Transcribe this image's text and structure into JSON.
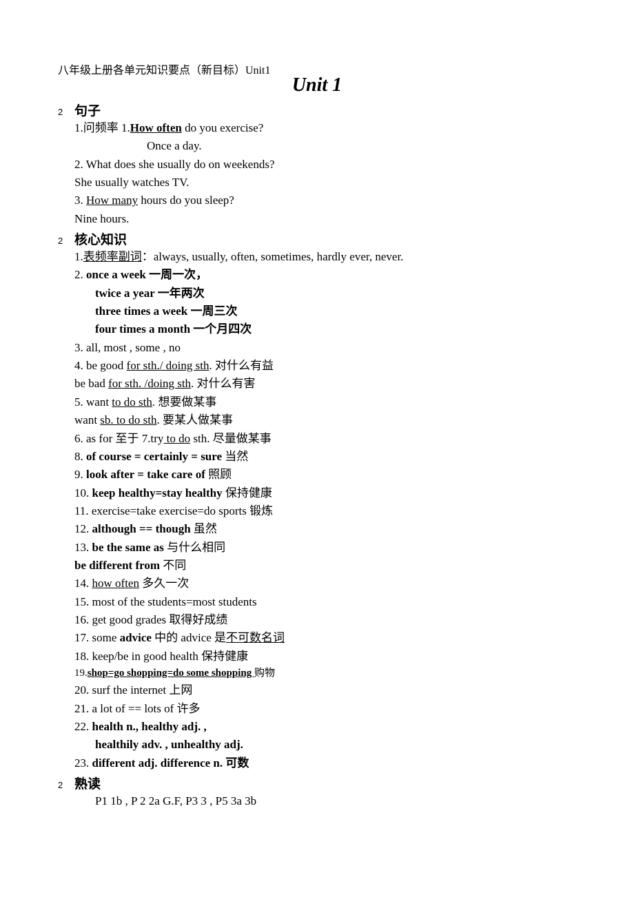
{
  "header": "八年级上册各单元知识要点（新目标）Unit1",
  "title": "Unit 1",
  "sec_bullet": "2",
  "sections": {
    "juzi": {
      "label": "句子",
      "l1_pre": "1.问频率  1.",
      "l1_bold": "How often",
      "l1_post": " do you exercise?",
      "l2": "Once a day.",
      "l3": "2. What does she usually do on weekends?",
      "l4": "She usually watches TV.",
      "l5_pre": "3. ",
      "l5_u": "How many",
      "l5_post": " hours do you sleep?",
      "l6": "Nine hours."
    },
    "hexin": {
      "label": "核心知识",
      "l1_pre": "1.",
      "l1_u": "表频率副词",
      "l1_post": "：always, usually, often, sometimes, hardly ever, never.",
      "l2_pre": "2. ",
      "l2_b": "once a week  一周一次，",
      "l3": "twice a year  一年两次",
      "l4": "three times a week  一周三次",
      "l5": "four times a month  一个月四次",
      "l6": "3. all, most , some , no",
      "l7_pre": "4. be good ",
      "l7_u": "for sth./ doing sth",
      "l7_post": ".  对什么有益",
      "l8_pre": "be bad ",
      "l8_u": "for sth. /doing sth",
      "l8_post": ".  对什么有害",
      "l9_pre": "5. want ",
      "l9_u": "to do sth",
      "l9_post": ".  想要做某事",
      "l10_pre": "want ",
      "l10_u": "sb. to do sth",
      "l10_post": ".  要某人做某事",
      "l11_pre": "6. as for 至于          7.try",
      "l11_u": " to do",
      "l11_post": " sth.  尽量做某事",
      "l12_pre": "8. ",
      "l12_b": "of course = certainly = sure ",
      "l12_post": "当然",
      "l13_pre": "9. ",
      "l13_b": "look after = take care of ",
      "l13_post": " 照顾",
      "l14_pre": "10. ",
      "l14_b": "keep healthy=stay healthy ",
      "l14_post": " 保持健康",
      "l15": "11. exercise=take exercise=do sports 锻炼",
      "l16_pre": "12. ",
      "l16_b": "although == though ",
      "l16_post": "虽然",
      "l17_pre": "13. ",
      "l17_b": "be the same as ",
      "l17_post": " 与什么相同",
      "l18_b": "be different from ",
      "l18_post": " 不同",
      "l19_pre": "14. ",
      "l19_u": "how often",
      "l19_post": "  多久一次",
      "l20": "15. most of the students=most students",
      "l21": "16. get good grades 取得好成绩",
      "l22_pre": "17. some ",
      "l22_b": "advice ",
      "l22_mid": " 中的 advice 是",
      "l22_u": "不可数名词",
      "l23": "18. keep/be in good health 保持健康",
      "l24_pre": "19.",
      "l24_u": "shop=go shopping=do some shopping ",
      "l24_post": "购物",
      "l25": "20. surf the internet  上网",
      "l26": "21. a lot of == lots of  许多",
      "l27_pre": "22. ",
      "l27_b": "health n.,             healthy adj. ,",
      "l28": "healthily adv. , unhealthy adj.",
      "l29_pre": "23. ",
      "l29_b": "different adj. difference n.  可数"
    },
    "shudu": {
      "label": "熟读",
      "l1": "P1 1b , P 2 2a G.F, P3 3 , P5 3a 3b"
    }
  }
}
